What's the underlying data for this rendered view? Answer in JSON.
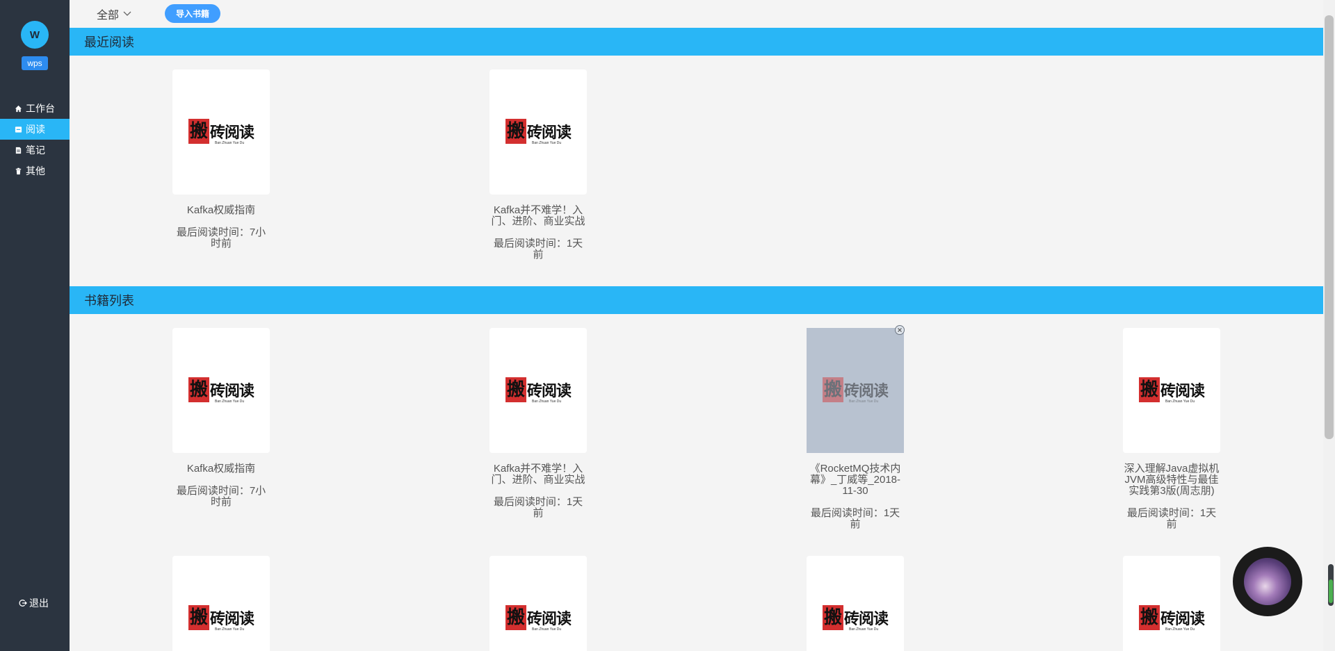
{
  "user": {
    "avatar_initial": "W",
    "name": "wps"
  },
  "nav": {
    "items": [
      {
        "label": "工作台",
        "icon": "home-icon",
        "active": false
      },
      {
        "label": "阅读",
        "icon": "book-icon",
        "active": true
      },
      {
        "label": "笔记",
        "icon": "note-icon",
        "active": false
      },
      {
        "label": "其他",
        "icon": "trash-icon",
        "active": false
      }
    ],
    "logout_label": "退出"
  },
  "toolbar": {
    "filter_label": "全部",
    "import_label": "导入书籍"
  },
  "recent": {
    "title": "最近阅读",
    "books": [
      {
        "title": "Kafka权威指南",
        "time": "最后阅读时间：7小时前"
      },
      {
        "title": "Kafka并不难学！入门、进阶、商业实战",
        "time": "最后阅读时间：1天前"
      }
    ]
  },
  "library": {
    "title": "书籍列表",
    "books": [
      {
        "title": "Kafka权威指南",
        "time": "最后阅读时间：7小时前"
      },
      {
        "title": "Kafka并不难学！入门、进阶、商业实战",
        "time": "最后阅读时间：1天前"
      },
      {
        "title": "《RocketMQ技术内幕》_丁威等_2018-11-30",
        "time": "最后阅读时间：1天前",
        "selected": true
      },
      {
        "title": "深入理解Java虚拟机JVM高级特性与最佳实践第3版(周志朋)",
        "time": "最后阅读时间：1天前"
      },
      {
        "title": "",
        "time": ""
      },
      {
        "title": "",
        "time": ""
      },
      {
        "title": "",
        "time": ""
      },
      {
        "title": "",
        "time": ""
      }
    ]
  },
  "cover_logo": {
    "seal": "搬",
    "text": "砖阅读",
    "subtitle": "Ban Zhuan Yue Du"
  },
  "colors": {
    "sidebar": "#2b3440",
    "accent": "#29b6f6",
    "button": "#409eff"
  }
}
